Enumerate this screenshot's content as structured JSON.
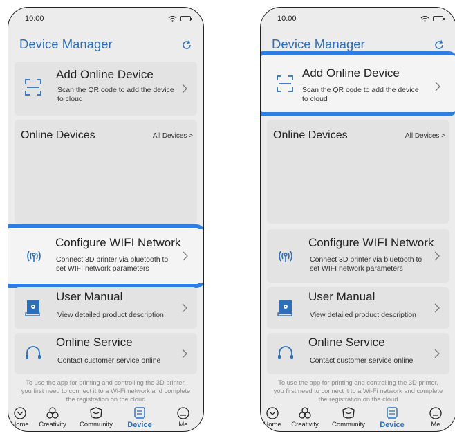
{
  "status": {
    "time": "10:00"
  },
  "header": {
    "title": "Device Manager"
  },
  "add_device": {
    "title": "Add Online Device",
    "desc": "Scan the QR code to add the device to cloud"
  },
  "online": {
    "label": "Online Devices",
    "all": "All Devices >"
  },
  "wifi": {
    "title": "Configure WIFI Network",
    "desc": "Connect 3D printer via bluetooth to set WIFI network parameters"
  },
  "manual": {
    "title": "User Manual",
    "desc": "View detailed product description"
  },
  "service": {
    "title": "Online Service",
    "desc": "Contact customer service online"
  },
  "note": "To use the app for printing and controlling the 3D printer, you first need to connect it to a Wi-Fi network and complete the registration on the cloud",
  "nav": {
    "home": "Home",
    "creativity": "Creativity",
    "community": "Community",
    "device": "Device",
    "me": "Me"
  },
  "colors": {
    "accent": "#2e6fb8",
    "highlight": "#2c7fe0"
  }
}
